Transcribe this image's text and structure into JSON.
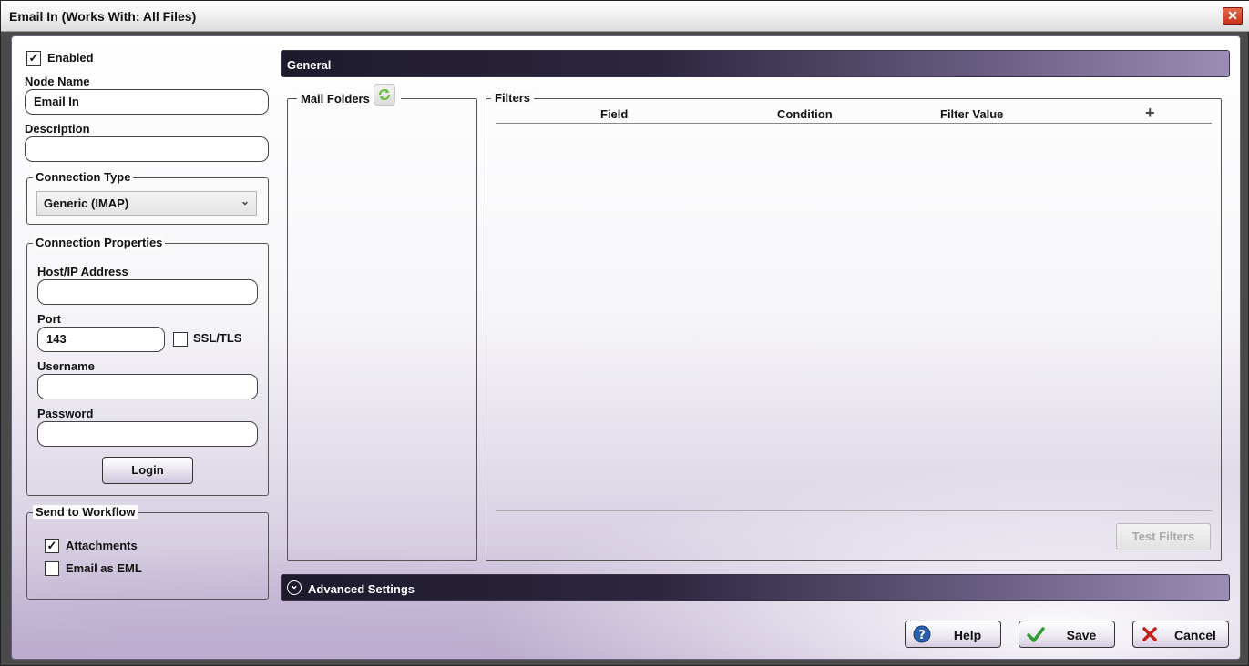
{
  "window": {
    "title": "Email In (Works With: All Files)",
    "close_glyph": "✕"
  },
  "left": {
    "enabled_label": "Enabled",
    "enabled_checked": true,
    "node_name_label": "Node Name",
    "node_name_value": "Email In",
    "description_label": "Description",
    "description_value": "",
    "connection_type": {
      "legend": "Connection Type",
      "selected": "Generic (IMAP)"
    },
    "connection_properties": {
      "legend": "Connection Properties",
      "host_label": "Host/IP Address",
      "host_value": "",
      "port_label": "Port",
      "port_value": "143",
      "ssl_label": "SSL/TLS",
      "ssl_checked": false,
      "username_label": "Username",
      "username_value": "",
      "password_label": "Password",
      "password_value": "",
      "login_label": "Login"
    },
    "send_to_workflow": {
      "legend": "Send to Workflow",
      "attachments_label": "Attachments",
      "attachments_checked": true,
      "eml_label": "Email as EML",
      "eml_checked": false
    }
  },
  "general": {
    "header": "General",
    "mail_folders_label": "Mail Folders",
    "filters": {
      "legend": "Filters",
      "columns": [
        "Field",
        "Condition",
        "Filter Value"
      ],
      "add_glyph": "+",
      "test_button": "Test Filters"
    }
  },
  "advanced": {
    "header": "Advanced Settings",
    "expand_glyph": "⌄"
  },
  "footer": {
    "help_label": "Help",
    "save_label": "Save",
    "cancel_label": "Cancel"
  },
  "colors": {
    "accent_dark": "#1e1a2c",
    "accent_light": "#9b8db5",
    "close_red": "#c8321b",
    "save_green": "#2f9a2f",
    "cancel_red": "#c0201a",
    "help_blue": "#2a5ea8"
  }
}
